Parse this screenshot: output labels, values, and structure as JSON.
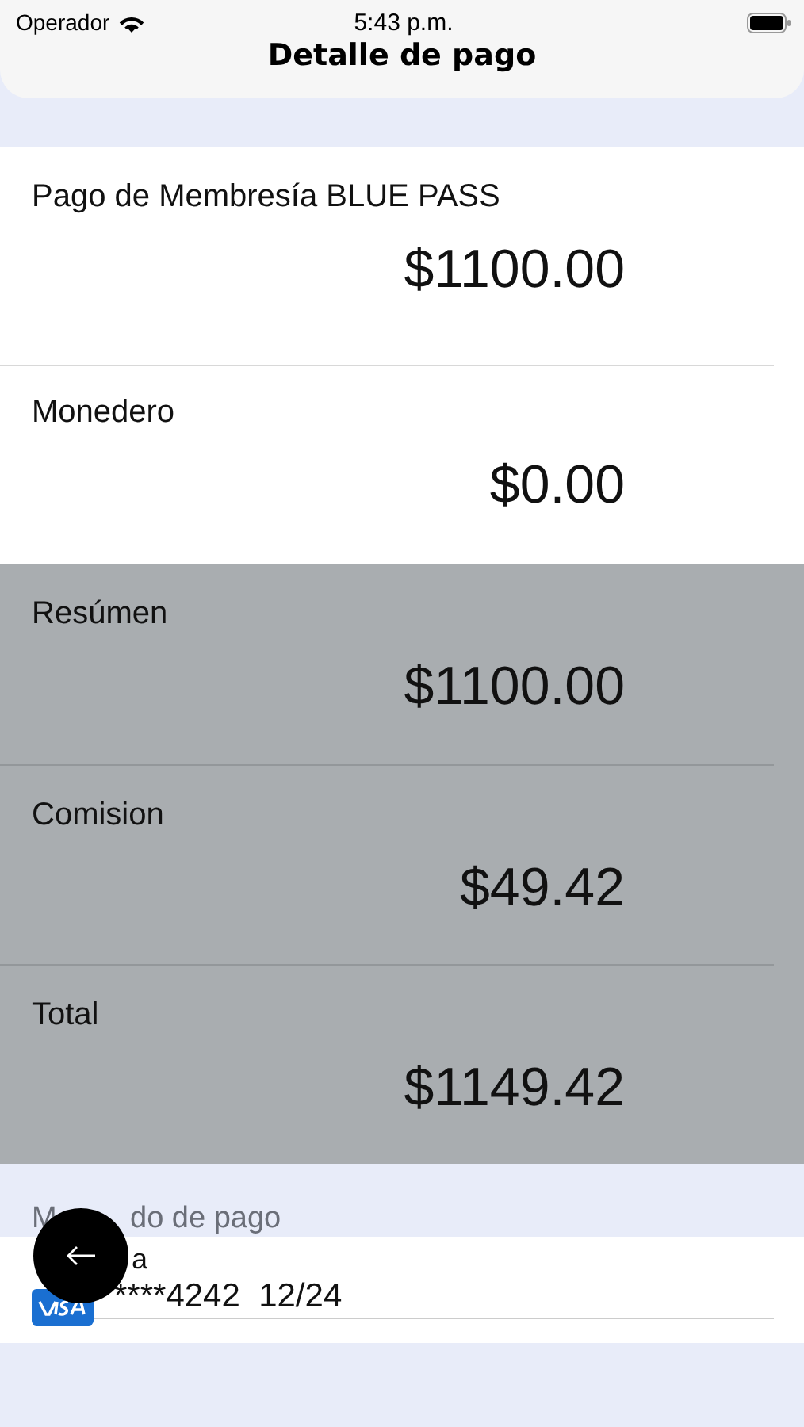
{
  "status_bar": {
    "carrier": "Operador",
    "time": "5:43 p.m."
  },
  "title": "Detalle de pago",
  "sections": [
    {
      "kind": "plain",
      "rows": [
        {
          "label": "Pago de Membresía BLUE PASS",
          "amount": "$1100.00"
        },
        {
          "label": "Monedero",
          "amount": "$0.00"
        }
      ]
    },
    {
      "kind": "shaded",
      "rows": [
        {
          "label": "Resúmen",
          "amount": "$1100.00"
        },
        {
          "label": "Comision",
          "amount": "$49.42"
        },
        {
          "label": "Total",
          "amount": "$1149.42"
        }
      ]
    }
  ],
  "payment": {
    "label_start": "M",
    "label_end": "do de pago",
    "card_type_end": "a",
    "card_number": "****4242",
    "expiry": "12/24"
  }
}
